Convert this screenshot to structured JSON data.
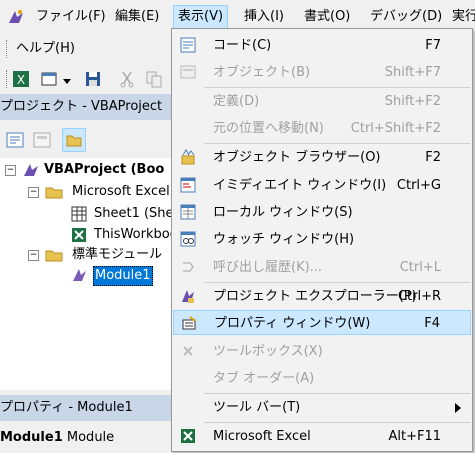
{
  "menubar": {
    "items": [
      "ファイル(F)",
      "編集(E)",
      "表示(V)",
      "挿入(I)",
      "書式(O)",
      "デバッグ(D)",
      "実行"
    ],
    "help": "ヘルプ(H)"
  },
  "project": {
    "title": "プロジェクト - VBAProject",
    "tree": {
      "root": "VBAProject (Boo",
      "folder_excel": "Microsoft Excel",
      "sheet1": "Sheet1 (She",
      "thisworkbook": "ThisWorkboo",
      "folder_std": "標準モジュール",
      "module1": "Module1"
    }
  },
  "properties": {
    "title": "プロパティ - Module1",
    "object_name": "Module1",
    "object_type": "Module"
  },
  "view_menu": {
    "items": [
      {
        "label": "コード(C)",
        "shortcut": "F7",
        "icon": "code-icon",
        "disabled": false
      },
      {
        "label": "オブジェクト(B)",
        "shortcut": "Shift+F7",
        "icon": "object-icon",
        "disabled": true
      },
      {
        "label": "定義(D)",
        "shortcut": "Shift+F2",
        "icon": "",
        "disabled": true
      },
      {
        "label": "元の位置へ移動(N)",
        "shortcut": "Ctrl+Shift+F2",
        "icon": "",
        "disabled": true
      },
      {
        "label": "オブジェクト ブラウザー(O)",
        "shortcut": "F2",
        "icon": "object-browser-icon",
        "disabled": false
      },
      {
        "label": "イミディエイト ウィンドウ(I)",
        "shortcut": "Ctrl+G",
        "icon": "immediate-window-icon",
        "disabled": false
      },
      {
        "label": "ローカル ウィンドウ(S)",
        "shortcut": "",
        "icon": "locals-window-icon",
        "disabled": false
      },
      {
        "label": "ウォッチ ウィンドウ(H)",
        "shortcut": "",
        "icon": "watch-window-icon",
        "disabled": false
      },
      {
        "label": "呼び出し履歴(K)...",
        "shortcut": "Ctrl+L",
        "icon": "call-stack-icon",
        "disabled": true
      },
      {
        "label": "プロジェクト エクスプローラー(P)",
        "shortcut": "Ctrl+R",
        "icon": "project-explorer-icon",
        "disabled": false
      },
      {
        "label": "プロパティ ウィンドウ(W)",
        "shortcut": "F4",
        "icon": "properties-window-icon",
        "disabled": false
      },
      {
        "label": "ツールボックス(X)",
        "shortcut": "",
        "icon": "toolbox-icon",
        "disabled": true
      },
      {
        "label": "タブ オーダー(A)",
        "shortcut": "",
        "icon": "",
        "disabled": true
      },
      {
        "label": "ツール バー(T)",
        "shortcut": "",
        "icon": "",
        "disabled": false
      },
      {
        "label": "Microsoft Excel",
        "shortcut": "Alt+F11",
        "icon": "excel-icon",
        "disabled": false
      }
    ]
  },
  "colors": {
    "highlight": "#cce8ff",
    "selection": "#0078d7",
    "pane_title": "#c8d6e8"
  }
}
